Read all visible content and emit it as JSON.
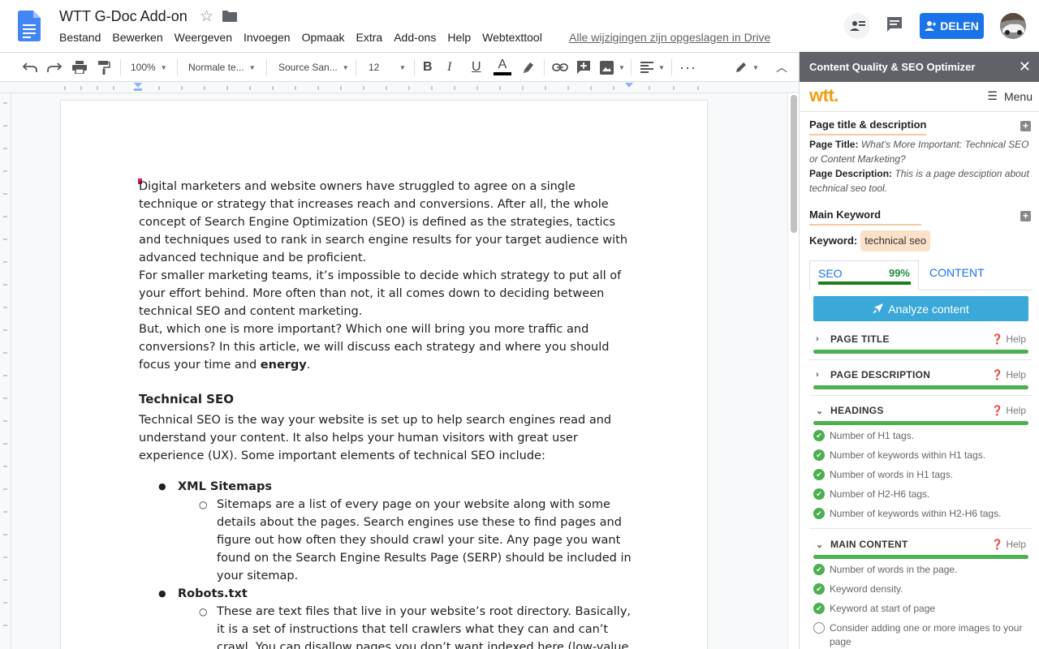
{
  "header": {
    "doc_title": "WTT G-Doc Add-on",
    "menus": [
      "Bestand",
      "Bewerken",
      "Weergeven",
      "Invoegen",
      "Opmaak",
      "Extra",
      "Add-ons",
      "Help",
      "Webtexttool"
    ],
    "save_status": "Alle wijzigingen zijn opgeslagen in Drive",
    "share_label": "DELEN"
  },
  "toolbar": {
    "zoom": "100%",
    "style": "Normale te...",
    "font": "Source San...",
    "font_size": "12"
  },
  "document": {
    "paragraphs": [
      "Digital marketers and website owners have struggled to agree on a single technique or strategy that increases reach and conversions. After all, the whole concept of Search Engine Optimization (SEO) is defined as the strategies, tactics and techniques used to rank in search engine results for your target audience with advanced technique and be proficient.",
      "For smaller marketing teams, it’s impossible to decide which strategy to put all of your effort behind. More often than not, it all comes down to deciding between technical SEO and content marketing.",
      "But, which one is more important? Which one will bring you more traffic and conversions? In this article, we will discuss each strategy and where you should focus your time and"
    ],
    "bold_word": "energy",
    "period": ".",
    "heading": "Technical SEO",
    "heading_paragraph": "Technical SEO is the way your website is set up to help search engines read and understand your content. It also helps your human visitors with great user experience (UX). Some important elements of technical SEO include:",
    "list": [
      {
        "title": "XML Sitemaps",
        "sub": "Sitemaps are a list of every page on your website along with some details about the pages. Search engines use these to find pages and figure out how often they should crawl your site. Any page you want found on the Search Engine Results Page (SERP) should be included in your sitemap."
      },
      {
        "title": "Robots.txt",
        "sub": "These are text files that live in your website’s root directory. Basically, it is a set of instructions that tell crawlers what they can and can’t crawl. You can disallow pages you don’t want indexed here (low-value pages, duplicate content, etc.)."
      }
    ]
  },
  "sidebar": {
    "title": "Content Quality & SEO Optimizer",
    "logo": "wtt.",
    "menu_label": "Menu",
    "page_section": {
      "title": "Page title & description",
      "page_title_label": "Page Title:",
      "page_title_value": "What's More Important: Technical SEO or Content Marketing?",
      "page_desc_label": "Page Description:",
      "page_desc_value": "This is a page desciption about technical seo tool."
    },
    "keyword_section": {
      "title": "Main Keyword",
      "label": "Keyword:",
      "value": "technical seo"
    },
    "tabs": {
      "seo_label": "SEO",
      "seo_score": "99%",
      "content_label": "CONTENT"
    },
    "analyze_label": "Analyze content",
    "help_label": "Help",
    "sections": {
      "page_title": "PAGE TITLE",
      "page_description": "PAGE DESCRIPTION",
      "headings": "HEADINGS",
      "main_content": "MAIN CONTENT"
    },
    "headings_checks": [
      "Number of H1 tags.",
      "Number of keywords within H1 tags.",
      "Number of words in H1 tags.",
      "Number of H2-H6 tags.",
      "Number of keywords within H2-H6 tags."
    ],
    "main_content_checks": [
      "Number of words in the page.",
      "Keyword density.",
      "Keyword at start of page",
      "Consider adding one or more images to your page"
    ]
  },
  "colors": {
    "share_blue": "#1a73e8",
    "analyze_blue": "#3aa8d8",
    "score_green": "#4caf50",
    "logo_orange": "#f39c12"
  }
}
